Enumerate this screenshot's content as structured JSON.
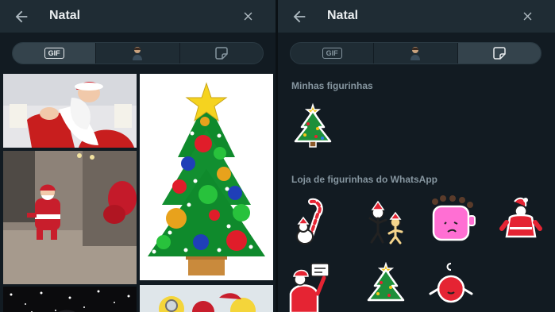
{
  "left": {
    "search": {
      "query": "Natal"
    },
    "tabs": [
      {
        "kind": "gif",
        "label": "GIF",
        "active": true
      },
      {
        "kind": "avatar",
        "label": "",
        "active": false
      },
      {
        "kind": "sticker",
        "label": "",
        "active": false
      }
    ],
    "icons": {
      "back": "arrow-left-icon",
      "close": "close-icon"
    }
  },
  "right": {
    "search": {
      "query": "Natal"
    },
    "tabs": [
      {
        "kind": "gif",
        "label": "GIF",
        "active": false
      },
      {
        "kind": "avatar",
        "label": "",
        "active": false
      },
      {
        "kind": "sticker",
        "label": "",
        "active": true
      }
    ],
    "sections": {
      "my_stickers": "Minhas figurinhas",
      "store": "Loja de figurinhas do WhatsApp"
    }
  },
  "colors": {
    "background": "#121b22",
    "header": "#1f2c34",
    "text": "#e9edef",
    "muted": "#8696a0"
  }
}
